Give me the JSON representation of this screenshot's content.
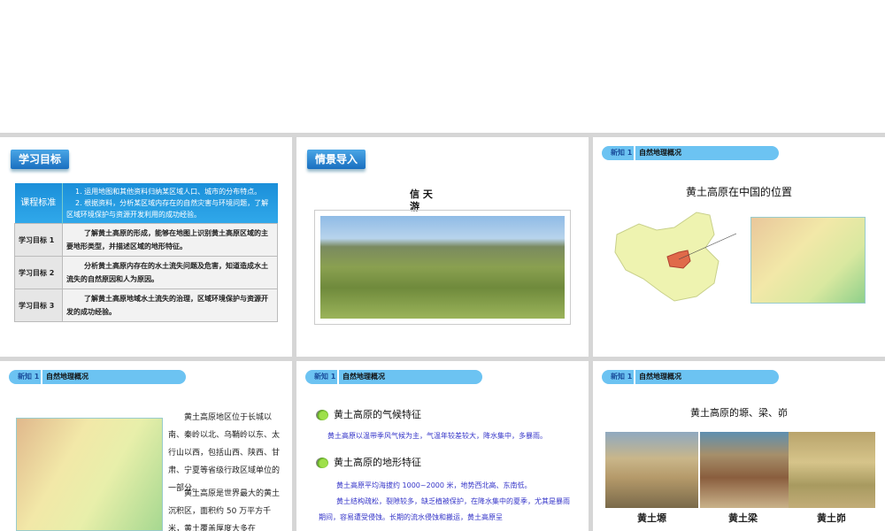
{
  "slide1": {
    "badge": "学习目标",
    "std_label": "课程标准",
    "std_1": "1. 运用地图和其他资料归纳某区域人口、城市的分布特点。",
    "std_2": "2. 根据资料，分析某区域内存在的自然灾害与环境问题，了解区域环境保护与资源开发利用的成功经验。",
    "goals": [
      {
        "label": "学习目标 1",
        "text": "了解黄土高原的形成，能够在地图上识别黄土高原区域的主要地形类型，并描述区域的地形特征。"
      },
      {
        "label": "学习目标 2",
        "text": "分析黄土高原内存在的水土流失问题及危害，知道造成水土流失的自然原因和人为原因。"
      },
      {
        "label": "学习目标 3",
        "text": "了解黄土高原地域水土流失的治理，区域环境保护与资源开发的成功经验。"
      }
    ]
  },
  "slide2": {
    "badge": "情景导入",
    "title_a": "信 天",
    "title_b": "游"
  },
  "section": {
    "num": "新知 1",
    "title": "自然地理概况"
  },
  "slide3": {
    "title": "黄土高原在中国的位置"
  },
  "slide4": {
    "p1": "黄土高原地区位于长城以南、秦岭以北、乌鞘岭以东、太行山以西，包括山西、陕西、甘肃、宁夏等省级行政区域单位的一部分。",
    "p2": "黄土高原是世界最大的黄土沉积区，面积约 50 万平方千米，黄土覆盖厚度大多在"
  },
  "slide5": {
    "h1": "黄土高原的气候特征",
    "t1": "黄土高原以温带季风气候为主，气温年较差较大，降水集中，多暴雨。",
    "h2": "黄土高原的地形特征",
    "t2": "黄土高原平均海拔约 1000~2000 米，地势西北高、东南低。",
    "t3": "黄土结构疏松，裂隙较多，缺乏植被保护，在降水集中的夏季，尤其是暴雨期间，容易遭受侵蚀。长期的流水侵蚀和搬运，黄土高原呈"
  },
  "slide6": {
    "title": "黄土高原的塬、梁、峁",
    "captions": [
      "黄土塬",
      "黄土梁",
      "黄土峁"
    ]
  }
}
